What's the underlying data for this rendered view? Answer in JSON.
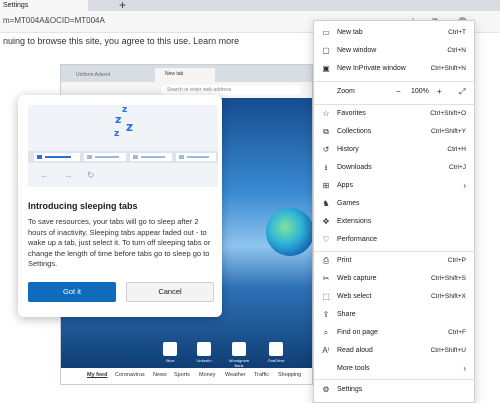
{
  "browser": {
    "tab_title": "Settings",
    "new_tab_symbol": "+",
    "url": "m=MT004A&OCID=MT004A",
    "notice": "nuing to browse this site, you agree to this use. Learn more"
  },
  "inner_browser": {
    "tab1": "Uniform Advent",
    "tab2": "New tab",
    "address_placeholder": "Search or enter web address",
    "tiles": [
      "Xbox",
      "LinkedIn",
      "Woodgrove Bank",
      "OneDrive"
    ],
    "feed": [
      "My feed",
      "Coronavirus",
      "News",
      "Sports",
      "Money",
      "Weather",
      "Traffic",
      "Shopping"
    ]
  },
  "dialog": {
    "title": "Introducing sleeping tabs",
    "body": "To save resources, your tabs will go to sleep after 2 hours of inactivity. Sleeping tabs appear faded out - to wake up a tab, just select it. To turn off sleeping tabs or change the length of time before tabs go to sleep go to Settings.",
    "primary_button": "Got it",
    "secondary_button": "Cancel",
    "accent": "#0f6cbd"
  },
  "menu": {
    "items_top": [
      {
        "icon": "new-tab-icon",
        "label": "New tab",
        "shortcut": "Ctrl+T"
      },
      {
        "icon": "new-window-icon",
        "label": "New window",
        "shortcut": "Ctrl+N"
      },
      {
        "icon": "inprivate-icon",
        "label": "New InPrivate window",
        "shortcut": "Ctrl+Shift+N"
      }
    ],
    "zoom": {
      "label": "Zoom",
      "minus": "−",
      "value": "100%",
      "plus": "+"
    },
    "items_mid": [
      {
        "icon": "favorites-icon",
        "label": "Favorites",
        "shortcut": "Ctrl+Shift+O"
      },
      {
        "icon": "collections-icon",
        "label": "Collections",
        "shortcut": "Ctrl+Shift+Y"
      },
      {
        "icon": "history-icon",
        "label": "History",
        "shortcut": "Ctrl+H"
      },
      {
        "icon": "downloads-icon",
        "label": "Downloads",
        "shortcut": "Ctrl+J"
      },
      {
        "icon": "apps-icon",
        "label": "Apps",
        "shortcut": "›"
      },
      {
        "icon": "games-icon",
        "label": "Games",
        "shortcut": ""
      },
      {
        "icon": "extensions-icon",
        "label": "Extensions",
        "shortcut": ""
      },
      {
        "icon": "performance-icon",
        "label": "Performance",
        "shortcut": ""
      }
    ],
    "items_bottom": [
      {
        "icon": "print-icon",
        "label": "Print",
        "shortcut": "Ctrl+P"
      },
      {
        "icon": "web-capture-icon",
        "label": "Web capture",
        "shortcut": "Ctrl+Shift+S"
      },
      {
        "icon": "web-select-icon",
        "label": "Web select",
        "shortcut": "Ctrl+Shift+X"
      },
      {
        "icon": "share-icon",
        "label": "Share",
        "shortcut": ""
      },
      {
        "icon": "find-icon",
        "label": "Find on page",
        "shortcut": "Ctrl+F"
      },
      {
        "icon": "read-aloud-icon",
        "label": "Read aloud",
        "shortcut": "Ctrl+Shift+U"
      },
      {
        "icon": "more-tools-icon",
        "label": "More tools",
        "shortcut": "›"
      }
    ],
    "items_last": [
      {
        "icon": "settings-icon",
        "label": "Settings",
        "shortcut": ""
      }
    ]
  }
}
